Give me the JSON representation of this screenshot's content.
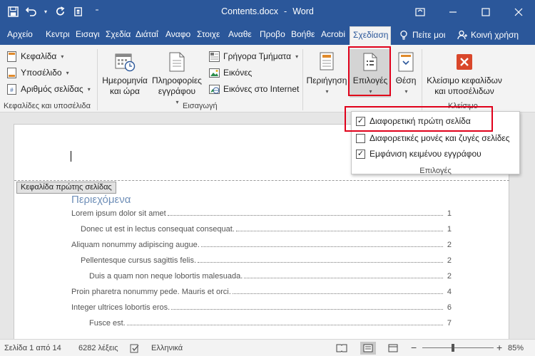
{
  "window": {
    "title": "Contents.docx",
    "app": "Word",
    "title_sep": "-",
    "brand_color": "#2b579a"
  },
  "qat": {
    "save_icon": "save-icon",
    "undo_icon": "undo-icon",
    "redo_icon": "redo-icon",
    "touch_icon": "touch-mode-icon",
    "customize_icon": "customize-qat-icon"
  },
  "tabs": [
    {
      "label": "Αρχείο"
    },
    {
      "label": "Κεντρι"
    },
    {
      "label": "Εισαγι"
    },
    {
      "label": "Σχεδία"
    },
    {
      "label": "Διάταΐ"
    },
    {
      "label": "Αναφο"
    },
    {
      "label": "Στοιχε"
    },
    {
      "label": "Αναθε"
    },
    {
      "label": "Προβο"
    },
    {
      "label": "Βοήθε"
    },
    {
      "label": "Acrobi"
    },
    {
      "label": "Σχεδίαση"
    }
  ],
  "tell_me": "Πείτε μοι",
  "share": "Κοινή χρήση",
  "ribbon": {
    "header": "Κεφαλίδα",
    "footer": "Υποσέλιδο",
    "page_number": "Αριθμός σελίδας",
    "group1_label": "Κεφαλίδες και υποσέλιδα",
    "date_time": [
      "Ημερομηνία",
      "και ώρα"
    ],
    "doc_info": [
      "Πληροφορίες",
      "εγγράφου"
    ],
    "quick_parts": "Γρήγορα Τμήματα",
    "pictures": "Εικόνες",
    "online_pictures": "Εικόνες στο Internet",
    "group2_label": "Εισαγωγή",
    "navigation": "Περιήγηση",
    "options": "Επιλογές",
    "position": "Θέση",
    "close_hf": [
      "Κλείσιμο κεφαλίδων",
      "και υποσέλιδων"
    ],
    "close_group_label": "Κλείσιμο"
  },
  "options_menu": {
    "items": [
      {
        "label": "Διαφορετική πρώτη σελίδα",
        "checked": "✓"
      },
      {
        "label": "Διαφορετικές μονές και ζυγές σελίδες",
        "checked": ""
      },
      {
        "label": "Εμφάνιση κειμένου εγγράφου",
        "checked": "✓"
      }
    ],
    "group_label": "Επιλογές"
  },
  "document": {
    "header_tag": "Κεφαλίδα πρώτης σελίδας",
    "toc_title": "Περιεχόμενα",
    "toc": [
      {
        "text": "Lorem ipsum dolor sit amet",
        "page": "1"
      },
      {
        "text": "Donec ut est in lectus consequat consequat.",
        "page": "1"
      },
      {
        "text": "Aliquam nonummy adipiscing augue.",
        "page": "2"
      },
      {
        "text": "Pellentesque cursus sagittis felis.",
        "page": "2"
      },
      {
        "text": "Duis a quam non neque lobortis malesuada.",
        "page": "2"
      },
      {
        "text": "Proin pharetra nonummy pede. Mauris et orci.",
        "page": "4"
      },
      {
        "text": "Integer ultrices lobortis eros.",
        "page": "6"
      },
      {
        "text": "Fusce est.",
        "page": "7"
      }
    ]
  },
  "status": {
    "page": "Σελίδα 1 από 14",
    "words": "6282 λέξεις",
    "language": "Ελληνικά",
    "zoom": "85%",
    "zoom_minus": "−",
    "zoom_plus": "+",
    "zoom_level": 0.85
  }
}
